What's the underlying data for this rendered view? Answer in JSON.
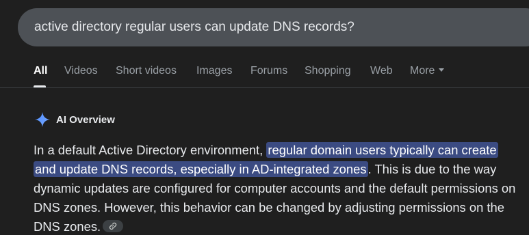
{
  "search": {
    "query": "active directory regular users can update DNS records?"
  },
  "tabs": [
    {
      "label": "All",
      "active": true
    },
    {
      "label": "Videos"
    },
    {
      "label": "Short videos"
    },
    {
      "label": "Images"
    },
    {
      "label": "Forums"
    },
    {
      "label": "Shopping"
    },
    {
      "label": "Web"
    },
    {
      "label": "More"
    }
  ],
  "ai_overview": {
    "title": "AI Overview",
    "icon": "sparkle-icon",
    "text_before": "In a default Active Directory environment, ",
    "highlight": "regular domain users typically can create and update DNS records, especially in AD-integrated zones",
    "text_after": ". This is due to the way dynamic updates are configured for computer accounts and the default permissions on DNS zones. However, this behavior can be changed by adjusting permissions on the DNS zones.",
    "link_icon": "link-icon"
  },
  "colors": {
    "background": "#1f1f1f",
    "search_bg": "#4d5156",
    "highlight": "#3b4b82",
    "sparkle": "#4285f4"
  }
}
